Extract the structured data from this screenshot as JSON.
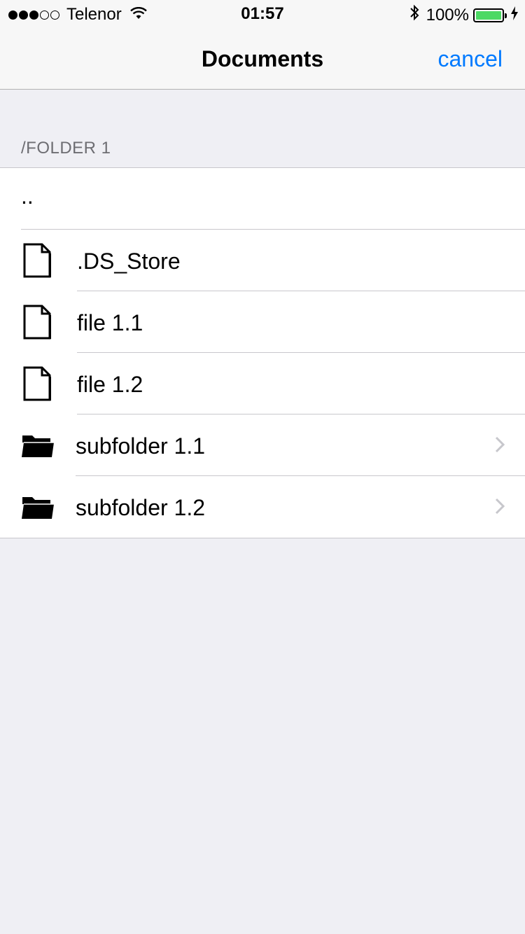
{
  "status": {
    "carrier": "Telenor",
    "time": "01:57",
    "battery": "100%",
    "signal_bars_filled": 3,
    "signal_bars_total": 5
  },
  "nav": {
    "title": "Documents",
    "cancel_label": "cancel"
  },
  "section": {
    "header": "/FOLDER 1"
  },
  "rows": [
    {
      "label": "..",
      "type": "parent"
    },
    {
      "label": ".DS_Store",
      "type": "file",
      "icon": "document-icon"
    },
    {
      "label": "file 1.1",
      "type": "file",
      "icon": "document-icon"
    },
    {
      "label": "file 1.2",
      "type": "file",
      "icon": "document-icon"
    },
    {
      "label": "subfolder 1.1",
      "type": "folder",
      "icon": "folder-icon"
    },
    {
      "label": "subfolder 1.2",
      "type": "folder",
      "icon": "folder-icon"
    }
  ],
  "colors": {
    "accent": "#007aff",
    "battery": "#4cd964",
    "background": "#efeff4"
  }
}
